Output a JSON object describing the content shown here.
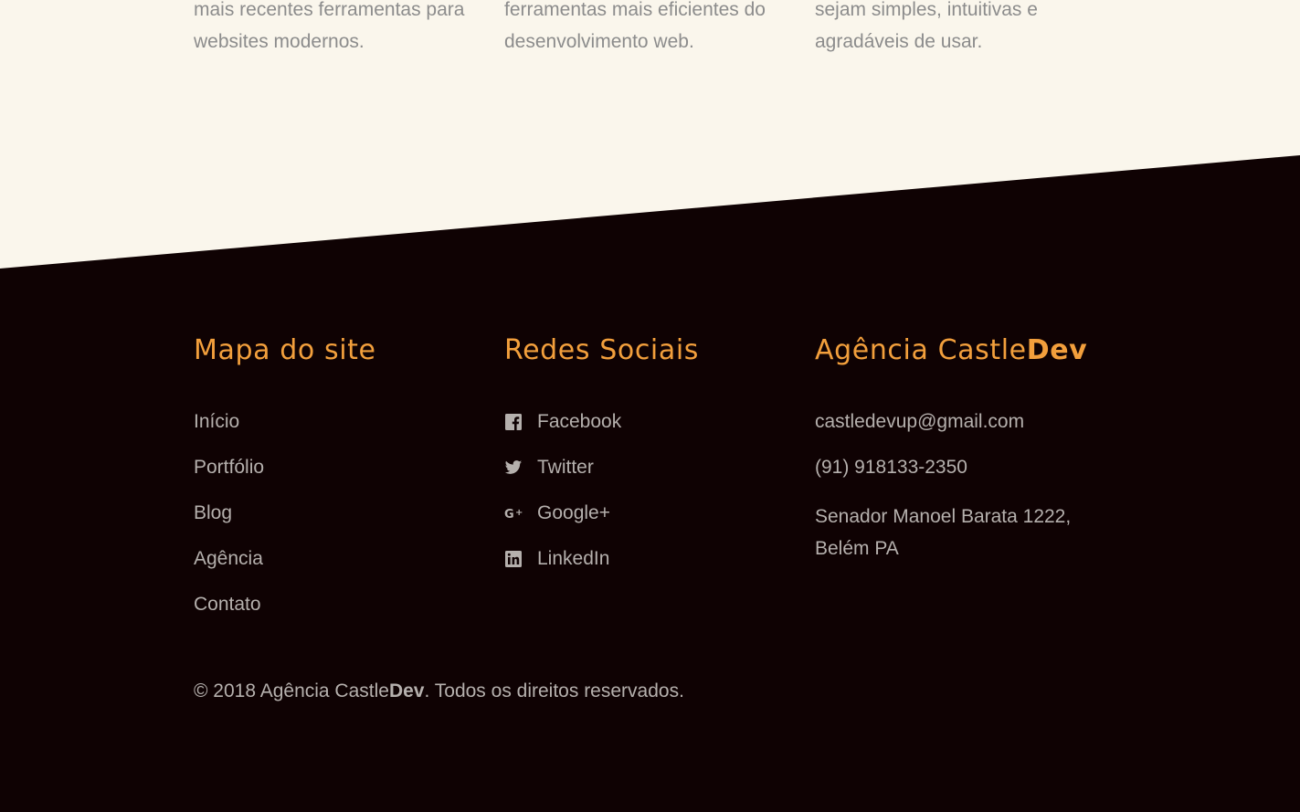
{
  "features": [
    {
      "line1": "mais recentes ferramentas para",
      "line2": "websites modernos."
    },
    {
      "line1": "ferramentas mais eficientes do",
      "line2": "desenvolvimento web."
    },
    {
      "line1": "sejam simples, intuitivas e",
      "line2": "agradáveis de usar."
    }
  ],
  "footer": {
    "sitemap": {
      "title": "Mapa do site",
      "links": [
        "Início",
        "Portfólio",
        "Blog",
        "Agência",
        "Contato"
      ]
    },
    "social": {
      "title": "Redes Sociais",
      "links": [
        {
          "label": "Facebook",
          "icon": "facebook-icon"
        },
        {
          "label": "Twitter",
          "icon": "twitter-icon"
        },
        {
          "label": "Google+",
          "icon": "google-plus-icon"
        },
        {
          "label": "LinkedIn",
          "icon": "linkedin-icon"
        }
      ]
    },
    "agency": {
      "title_prefix": "Agência Castle",
      "title_bold": "Dev",
      "email": "castledevup@gmail.com",
      "phone": "(91) 918133-2350",
      "address": "Senador Manoel Barata 1222, Belém PA"
    },
    "copyright": {
      "prefix": "© 2018 Agência Castle",
      "bold": "Dev",
      "suffix": ". Todos os direitos reservados."
    }
  },
  "colors": {
    "accent": "#f29f3c",
    "footer_bg": "#0f0203",
    "top_bg": "#faf6ec",
    "text_muted": "#b5b0ad"
  }
}
